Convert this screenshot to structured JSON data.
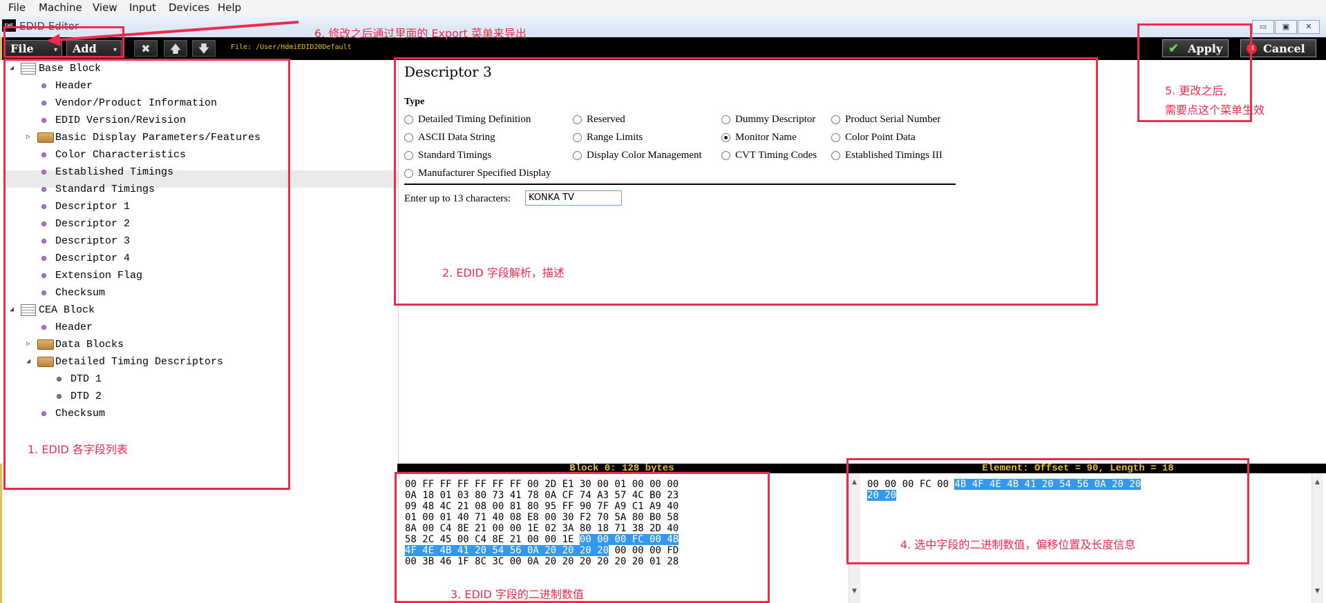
{
  "menubar": {
    "items": [
      "File",
      "Machine",
      "View",
      "Input",
      "Devices",
      "Help"
    ]
  },
  "window": {
    "title": "EDID Editor",
    "app_icon_text": "EWE",
    "minimize": "▭",
    "maximize": "▣",
    "close": "✕"
  },
  "toolbar": {
    "file_label": "File",
    "add_label": "Add",
    "dropdown_glyph": "▾",
    "delete_glyph": "✖",
    "up_glyph": "🡅",
    "down_glyph": "🡇",
    "file_path": "File: /User/HdmiEDID20Default",
    "apply_label": "Apply",
    "cancel_label": "Cancel"
  },
  "tree": {
    "base_block": "Base Block",
    "base_items": [
      "Header",
      "Vendor/Product Information",
      "EDID Version/Revision",
      "Basic Display Parameters/Features",
      "Color Characteristics",
      "Established Timings",
      "Standard Timings",
      "Descriptor 1",
      "Descriptor 2",
      "Descriptor 3",
      "Descriptor 4",
      "Extension Flag",
      "Checksum"
    ],
    "cea_block": "CEA Block",
    "cea_items": [
      "Header",
      "Data Blocks",
      "Detailed Timing Descriptors",
      "DTD 1",
      "DTD 2",
      "Checksum"
    ],
    "selected": "Descriptor 3"
  },
  "descriptor": {
    "title": "Descriptor 3",
    "type_label": "Type",
    "options": [
      "Detailed Timing Definition",
      "Reserved",
      "Dummy Descriptor",
      "Product Serial Number",
      "ASCII Data String",
      "Range Limits",
      "Monitor Name",
      "Color Point Data",
      "Standard Timings",
      "Display Color Management",
      "CVT Timing Codes",
      "Established Timings III",
      "Manufacturer Specified Display"
    ],
    "selected_option": "Monitor Name",
    "enter_label": "Enter up to 13 characters:",
    "name_value": "KONKA  TV"
  },
  "hex_panel": {
    "header": "Block 0: 128 bytes",
    "lines": [
      "00 FF FF FF FF FF FF 00 2D E1 30 00 01 00 00 00",
      "0A 18 01 03 80 73 41 78 0A CF 74 A3 57 4C B0 23",
      "09 48 4C 21 08 00 81 80 95 FF 90 7F A9 C1 A9 40",
      "01 00 01 40 71 40 08 E8 00 30 F2 70 5A 80 B0 58",
      "8A 00 C4 8E 21 00 00 1E 02 3A 80 18 71 38 2D 40",
      "58 2C 45 00 C4 8E 21 00 00 1E ",
      "00 00 00 FC 00 4B",
      "4F 4E 4B 41 20 54 56 0A 20 20 20 20",
      " 00 00 00 FD",
      "00 3B 46 1F 8C 3C 00 0A 20 20 20 20 20 20 01 28"
    ]
  },
  "element_panel": {
    "header": "Element: Offset = 90, Length = 18",
    "prefix": "00 00 00 FC 00 ",
    "highlight1": "4B 4F 4E 4B 41 20 54 56 0A 20 20",
    "highlight2": "20 20"
  },
  "annotations": {
    "a1": "1. EDID 各字段列表",
    "a2": "2. EDID 字段解析，描述",
    "a3": "3. EDID 字段的二进制数值",
    "a4": "4. 选中字段的二进制数值，偏移位置及长度信息",
    "a5_line1": "5. 更改之后,",
    "a5_line2": "需要点这个菜单生效",
    "a6": "6. 修改之后通过里面的 Export 菜单来导出"
  },
  "colors": {
    "annotation": "#ef2a4a",
    "highlight": "#3399ee",
    "header_text": "#e8c21a",
    "bullet": "#b070d0"
  }
}
